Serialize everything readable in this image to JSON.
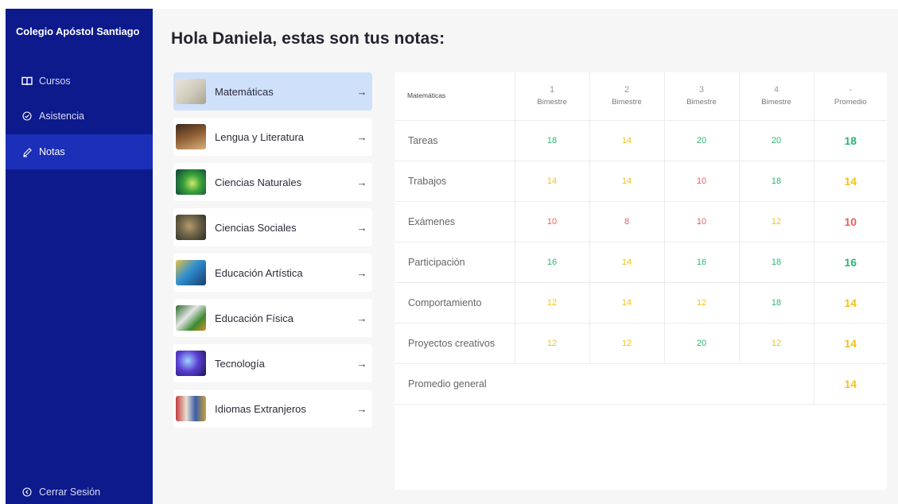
{
  "sidebar": {
    "school_name": "Colegio Apóstol Santiago",
    "items": [
      {
        "label": "Cursos",
        "icon": "book-icon"
      },
      {
        "label": "Asistencia",
        "icon": "check-circle-icon"
      },
      {
        "label": "Notas",
        "icon": "pencil-icon",
        "active": true
      }
    ],
    "logout_label": "Cerrar Sesión"
  },
  "main": {
    "title": "Hola Daniela, estas son tus notas:"
  },
  "courses": [
    {
      "label": "Matemáticas",
      "active": true
    },
    {
      "label": "Lengua y Literatura"
    },
    {
      "label": "Ciencias Naturales"
    },
    {
      "label": "Ciencias Sociales"
    },
    {
      "label": "Educación Artística"
    },
    {
      "label": "Educación Física"
    },
    {
      "label": "Tecnología"
    },
    {
      "label": "Idiomas Extranjeros"
    }
  ],
  "grades": {
    "subject": "Matemáticas",
    "columns": [
      {
        "num": "1",
        "label": "Bimestre"
      },
      {
        "num": "2",
        "label": "Bimestre"
      },
      {
        "num": "3",
        "label": "Bimestre"
      },
      {
        "num": "4",
        "label": "Bimestre"
      },
      {
        "num": "-",
        "label": "Promedio"
      }
    ],
    "rows": [
      {
        "label": "Tareas",
        "values": [
          "18",
          "14",
          "20",
          "20"
        ],
        "avg": "18"
      },
      {
        "label": "Trabajos",
        "values": [
          "14",
          "14",
          "10",
          "18"
        ],
        "avg": "14"
      },
      {
        "label": "Exámenes",
        "values": [
          "10",
          "8",
          "10",
          "12"
        ],
        "avg": "10"
      },
      {
        "label": "Participación",
        "values": [
          "16",
          "14",
          "16",
          "18"
        ],
        "avg": "16"
      },
      {
        "label": "Comportamiento",
        "values": [
          "12",
          "14",
          "12",
          "18"
        ],
        "avg": "14"
      },
      {
        "label": "Proyectos creativos",
        "values": [
          "12",
          "12",
          "20",
          "12"
        ],
        "avg": "14"
      }
    ],
    "general_label": "Promedio general",
    "general_avg": "14"
  },
  "colors": {
    "sidebar": "#0d1a8c",
    "active_nav": "#1c2fb8",
    "grade_high": "#2bb673",
    "grade_mid": "#f2c21b",
    "grade_low": "#ef5b5b",
    "active_course": "#cfe0fb"
  }
}
